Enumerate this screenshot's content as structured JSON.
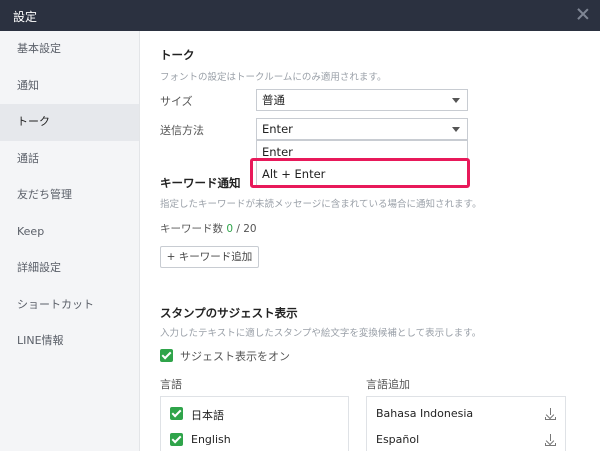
{
  "window": {
    "title": "設定"
  },
  "sidebar": {
    "items": [
      {
        "label": "基本設定"
      },
      {
        "label": "通知"
      },
      {
        "label": "トーク"
      },
      {
        "label": "通話"
      },
      {
        "label": "友だち管理"
      },
      {
        "label": "Keep"
      },
      {
        "label": "詳細設定"
      },
      {
        "label": "ショートカット"
      },
      {
        "label": "LINE情報"
      }
    ]
  },
  "talk": {
    "title": "トーク",
    "description": "フォントの設定はトークルームにのみ適用されます。",
    "size_label": "サイズ",
    "size_value": "普通",
    "send_label": "送信方法",
    "send_value": "Enter",
    "send_options": [
      "Enter",
      "Alt + Enter"
    ]
  },
  "keyword": {
    "title": "キーワード通知",
    "description": "指定したキーワードが未読メッセージに含まれている場合に通知されます。",
    "count_label": "キーワード数",
    "count_value": "0",
    "count_max": "/ 20",
    "add_button": "+ キーワード追加"
  },
  "sticker": {
    "title": "スタンプのサジェスト表示",
    "description": "入力したテキストに適したスタンプや絵文字を変換候補として表示します。",
    "suggest_label": "サジェスト表示をオン",
    "languages_header": "言語",
    "languages": [
      "日本語",
      "English"
    ],
    "add_language_header": "言語追加",
    "available_languages": [
      "Bahasa Indonesia",
      "Español"
    ]
  },
  "colors": {
    "accent_green": "#2fa44a",
    "highlight": "#e8195a",
    "titlebar": "#2b3140"
  }
}
